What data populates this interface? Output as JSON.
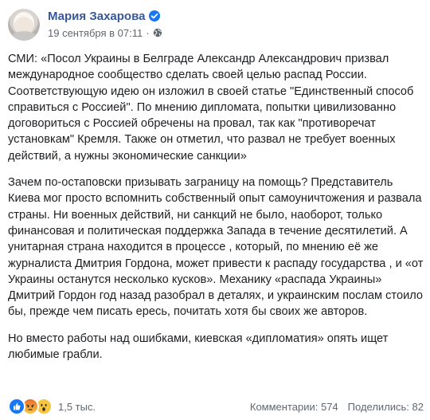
{
  "post": {
    "author": "Мария Захарова",
    "date": "19 сентября в 07:11",
    "meta_separator": "·",
    "paragraphs": [
      "СМИ: «Посол Украины в Белграде Александр Александрович призвал международное сообщество сделать своей целью распад России. Соответствующую идею он изложил в своей статье \"Единственный способ справиться с Россией\". По мнению дипломата, попытки цивилизованно договориться с Россией обречены на провал, так как \"противоречат установкам\" Кремля. Также он отметил, что развал не требует военных действий, а нужны экономические санкции»",
      "Зачем по-остаповски призывать заграницу на помощь? Представитель Киева мог просто вспомнить собственный опыт самоуничтожения и развала страны. Ни военных действий, ни санкций не было, наоборот, только финансовая и политическая поддержка Запада в течение десятилетий. А унитарная страна находится в процессе , который, по мнению её же журналиста Дмитрия Гордона, может привести к распаду государства , и «от Украины останутся несколько кусков». Механику «распада Украины» Дмитрий Гордон год назад разобрал в деталях, и украинским послам стоило бы, прежде чем писать ересь, почитать хотя бы своих же авторов.",
      "Но вместо работы над ошибками, киевская «дипломатия» опять ищет любимые грабли."
    ]
  },
  "footer": {
    "reactions_count": "1,5 тыс.",
    "comments": "Комментарии: 574",
    "shares": "Поделились: 82",
    "reaction_icons": [
      "like-icon",
      "angry-icon",
      "wow-icon"
    ]
  },
  "colors": {
    "author": "#385898",
    "text": "#1c1e21",
    "meta": "#606770",
    "like": "#1877f2",
    "wow": "#f7c640"
  }
}
